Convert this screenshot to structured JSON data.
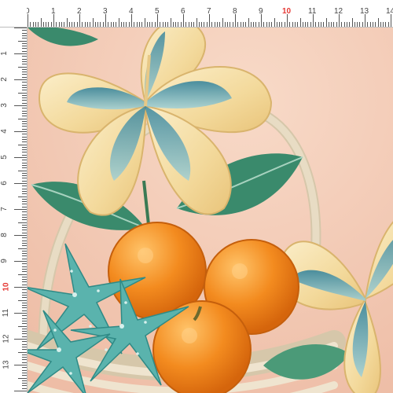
{
  "ruler": {
    "top_labels": [
      "0",
      "1",
      "2",
      "3",
      "4",
      "5",
      "6",
      "7",
      "8",
      "9",
      "10",
      "11",
      "12",
      "13",
      "14"
    ],
    "left_labels": [
      "1",
      "2",
      "3",
      "4",
      "5",
      "6",
      "7",
      "8",
      "9",
      "10",
      "11",
      "12",
      "13"
    ],
    "accent_label": "10",
    "accent_color": "#e53935",
    "unit": "cm"
  },
  "artwork": {
    "description_icon": "watercolor-pattern",
    "palette": {
      "background": "#f3cdb8",
      "petal_cream": "#f6e2ad",
      "petal_blue": "#3f8fa6",
      "orange": "#f08a1c",
      "starfish": "#5ab3ad",
      "leaf": "#2f7f64",
      "basket": "#e9dcc6"
    }
  }
}
